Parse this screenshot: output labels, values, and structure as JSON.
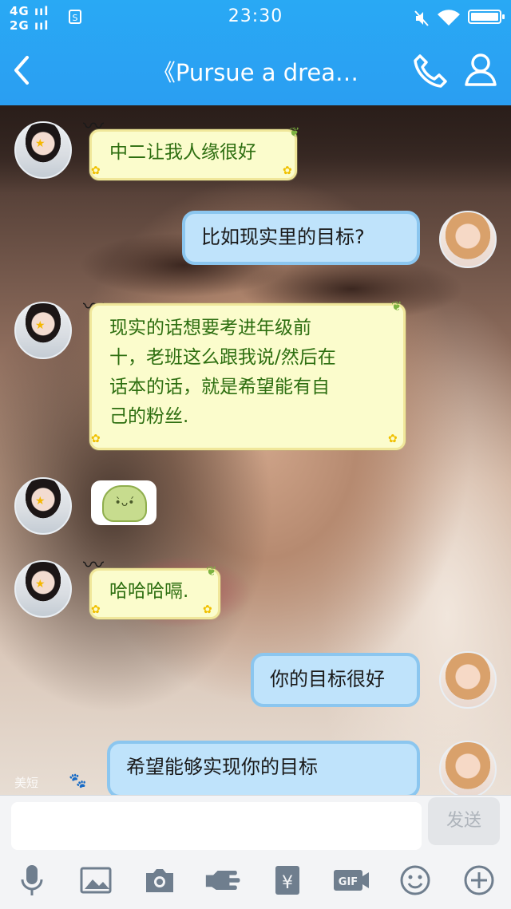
{
  "status_bar": {
    "signal_top": "4G ııl",
    "signal_bottom": "2G ııl",
    "sim_glyph": "S",
    "time": "23:30"
  },
  "header": {
    "title": "《Pursue a drea…"
  },
  "messages": [
    {
      "side": "them",
      "text": "中二让我人缘很好"
    },
    {
      "side": "me",
      "text": "比如现实里的目标?"
    },
    {
      "side": "them",
      "lines": [
        "现实的话想要考进年级前",
        "十，老班这么跟我说/然后在",
        "话本的话，就是希望能有自",
        "己的粉丝."
      ]
    },
    {
      "side": "them",
      "sticker": "sticker-face"
    },
    {
      "side": "them",
      "text": "哈哈哈嗝."
    },
    {
      "side": "me",
      "text": "你的目标很好"
    },
    {
      "side": "me",
      "text": "希望能够实现你的目标"
    }
  ],
  "bottom_widgets": {
    "left_label": "美短"
  },
  "composer": {
    "input_value": "",
    "send_label": "发送"
  },
  "toolbar": {
    "items": [
      "mic-icon",
      "image-icon",
      "camera-icon",
      "red-packet-hand-icon",
      "yuan-icon",
      "gif-icon",
      "emoji-icon",
      "plus-icon"
    ]
  },
  "colors": {
    "header_blue": "#2aa4f3",
    "bubble_in_bg": "#fbfccc",
    "bubble_in_text": "#2d6e10",
    "bubble_out_bg": "#bfe3fb",
    "bubble_out_border": "#8bc6ef"
  }
}
